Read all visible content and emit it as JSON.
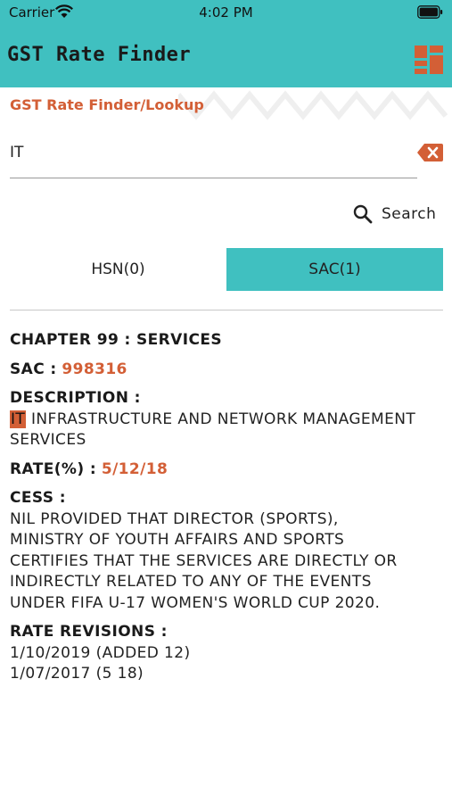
{
  "status_bar": {
    "carrier": "Carrier",
    "time": "4:02 PM"
  },
  "header": {
    "title": "GST Rate Finder",
    "accent_color": "#40c0c0",
    "menu_icon": "grid-icon"
  },
  "banner": {
    "label": "GST Rate Finder/Lookup"
  },
  "search": {
    "value": "IT",
    "clear_icon": "backspace-icon",
    "button_label": "Search",
    "button_icon": "search-icon"
  },
  "tabs": [
    {
      "label": "HSN(0)",
      "selected": false
    },
    {
      "label": "SAC(1)",
      "selected": true
    }
  ],
  "result": {
    "chapter": "CHAPTER 99 : SERVICES",
    "sac_label": "SAC :",
    "sac_value": "998316",
    "description_label": "DESCRIPTION :",
    "description_highlight": "IT",
    "description_line1_rest": "INFRASTRUCTURE AND NETWORK MANAGEMENT",
    "description_line2": "SERVICES",
    "rate_label": "RATE(%) :",
    "rate_value": "5/12/18",
    "cess_label": "CESS :",
    "cess_lines": [
      "NIL  PROVIDED THAT DIRECTOR (SPORTS),",
      "MINISTRY OF YOUTH AFFAIRS AND SPORTS",
      "CERTIFIES THAT THE SERVICES ARE DIRECTLY OR",
      "INDIRECTLY RELATED TO ANY OF THE EVENTS",
      "UNDER FIFA U-17 WOMEN'S WORLD CUP 2020."
    ],
    "revisions_label": "RATE REVISIONS :",
    "revisions": [
      "1/10/2019 (ADDED 12)",
      "1/07/2017 (5 18)"
    ]
  },
  "colors": {
    "accent": "#40c0c0",
    "highlight": "#d35f36"
  }
}
